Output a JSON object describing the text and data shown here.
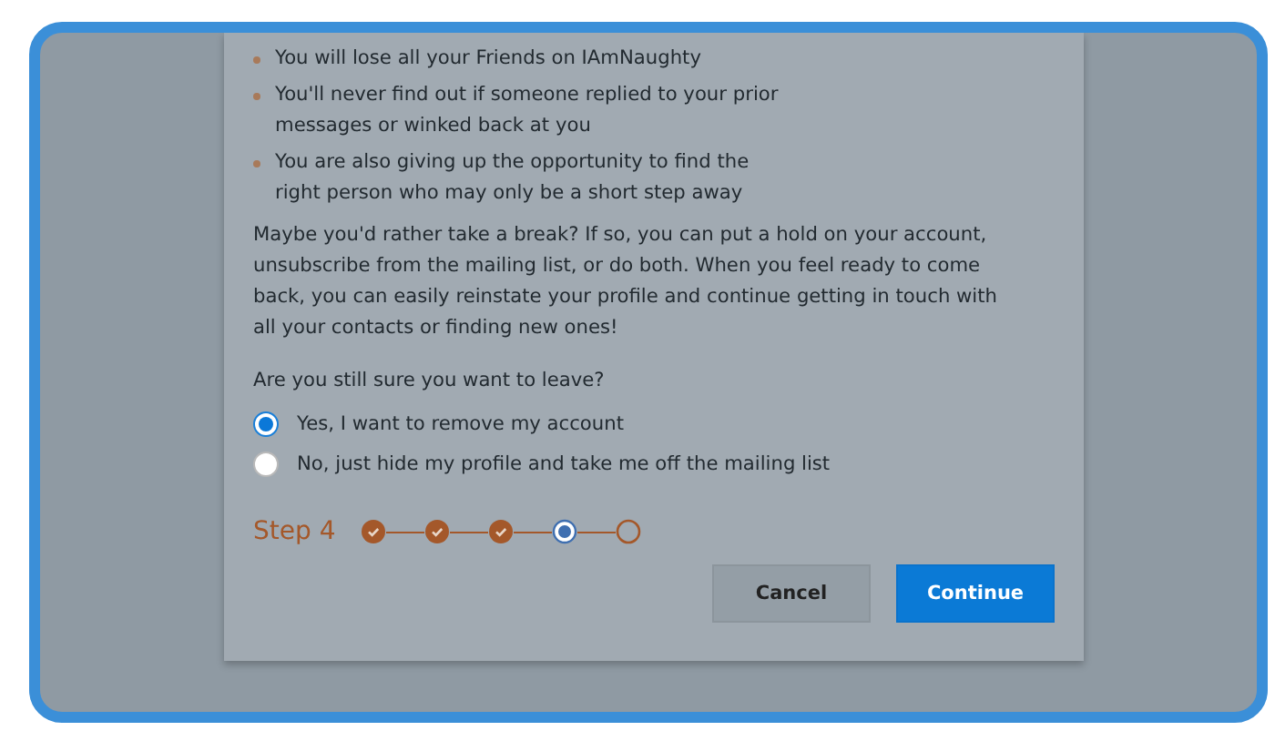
{
  "bullets": [
    {
      "text": "You will lose all your Friends on IAmNaughty"
    },
    {
      "text": "You'll never find out if someone replied to your prior messages or winked back at you"
    },
    {
      "text": "You are also giving up the opportunity to find the right person who may only be a short step away"
    }
  ],
  "paragraph": "Maybe you'd rather take a break? If so, you can put a hold on your account, unsubscribe from the mailing list, or do both. When you feel ready to come back, you can easily reinstate your profile and continue getting in touch with all your contacts or finding new ones!",
  "question": "Are you still sure you want to leave?",
  "options": [
    {
      "label": "Yes, I want to remove my account",
      "selected": true
    },
    {
      "label": "No, just hide my profile and take me off the mailing list",
      "selected": false
    }
  ],
  "progress": {
    "label": "Step 4",
    "steps": [
      {
        "done": true,
        "current": false
      },
      {
        "done": true,
        "current": false
      },
      {
        "done": true,
        "current": false
      },
      {
        "done": false,
        "current": true
      },
      {
        "done": false,
        "current": false
      }
    ]
  },
  "buttons": [
    {
      "label": "Cancel",
      "kind": "secondary"
    },
    {
      "label": "Continue",
      "kind": "primary"
    }
  ]
}
